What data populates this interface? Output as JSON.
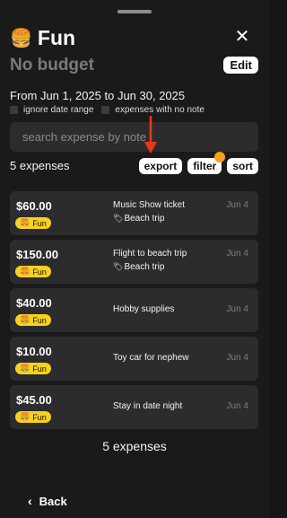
{
  "header": {
    "category_emoji": "🍔",
    "title": "Fun",
    "close_glyph": "✕",
    "budget": "No budget",
    "edit_label": "Edit"
  },
  "range": {
    "text": "From Jun 1, 2025 to Jun 30, 2025",
    "ignore_label": "ignore date range",
    "no_note_label": "expenses with no note"
  },
  "search": {
    "placeholder": "search expense by note"
  },
  "toolbar": {
    "count": "5 expenses",
    "export_label": "export",
    "filter_label": "filter",
    "sort_label": "sort",
    "filter_indicator_color": "#f4a21c"
  },
  "expenses": [
    {
      "amount": "$60.00",
      "category": "Fun",
      "category_emoji": "🍔",
      "note": "Music Show ticket",
      "trip": "Beach trip",
      "date": "Jun 4"
    },
    {
      "amount": "$150.00",
      "category": "Fun",
      "category_emoji": "🍔",
      "note": "Flight to beach trip",
      "trip": "Beach trip",
      "date": "Jun 4"
    },
    {
      "amount": "$40.00",
      "category": "Fun",
      "category_emoji": "🍔",
      "note": "Hobby supplies",
      "date": "Jun 4"
    },
    {
      "amount": "$10.00",
      "category": "Fun",
      "category_emoji": "🍔",
      "note": "Toy car for nephew",
      "date": "Jun 4"
    },
    {
      "amount": "$45.00",
      "category": "Fun",
      "category_emoji": "🍔",
      "note": "Stay in date night",
      "date": "Jun 4"
    }
  ],
  "footer": {
    "count": "5 expenses",
    "back_label": "Back",
    "back_glyph": "‹"
  },
  "colors": {
    "background": "#1a1a1a",
    "card": "#2c2c2e",
    "category_pill": "#f7d21d",
    "annotation_arrow": "#e8391d"
  },
  "icons": {
    "trip_tag": "🏷"
  }
}
